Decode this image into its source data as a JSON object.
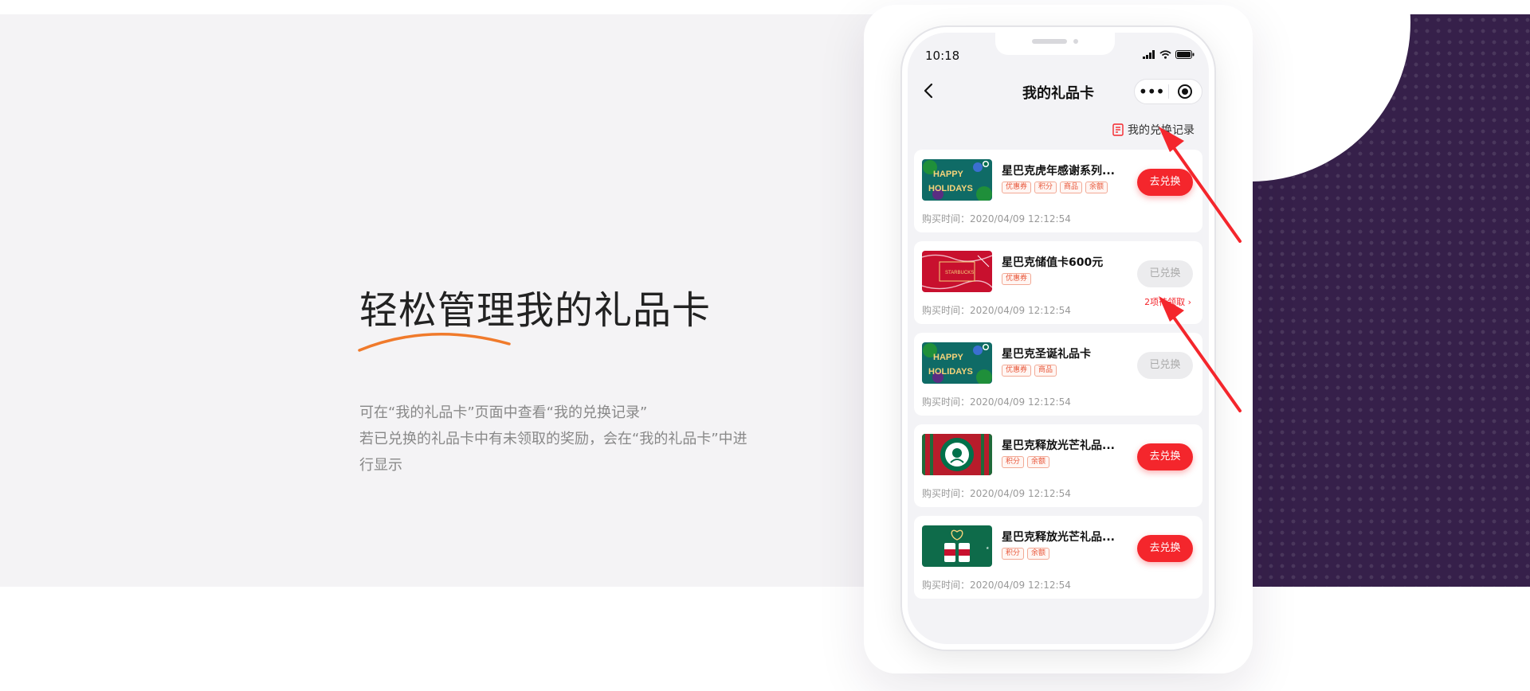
{
  "colors": {
    "accent": "#f4262c",
    "purple": "#36204a",
    "swoosh": "#f07a2b"
  },
  "feature": {
    "headline": "轻松管理我的礼品卡",
    "desc_line1": "可在“我的礼品卡”页面中查看“我的兑换记录”",
    "desc_line2": "若已兑换的礼品卡中有未领取的奖励，会在“我的礼品卡”中进行显示"
  },
  "phone": {
    "status_time": "10:18",
    "title": "我的礼品卡",
    "capsule_more": "•••",
    "records_link": "我的兑换记录",
    "cards": [
      {
        "name": "星巴克虎年感谢系列...",
        "tags": [
          "优惠券",
          "积分",
          "商品",
          "余额"
        ],
        "time": "购买时间：2020/04/09 12:12:54",
        "button": "去兑换",
        "thumb": "happy-holidays"
      },
      {
        "name": "星巴克储值卡600元",
        "tags": [
          "优惠券"
        ],
        "time": "购买时间：2020/04/09 12:12:54",
        "button": "已兑换",
        "pending": "2项待领取 ›",
        "thumb": "red-gift"
      },
      {
        "name": "星巴克圣诞礼品卡",
        "tags": [
          "优惠券",
          "商品"
        ],
        "time": "购买时间：2020/04/09 12:12:54",
        "button": "已兑换",
        "thumb": "happy-holidays"
      },
      {
        "name": "星巴克释放光芒礼品...",
        "tags": [
          "积分",
          "余额"
        ],
        "time": "购买时间：2020/04/09 12:12:54",
        "button": "去兑换",
        "thumb": "siren-logo"
      },
      {
        "name": "星巴克释放光芒礼品...",
        "tags": [
          "积分",
          "余额"
        ],
        "time": "购买时间：2020/04/09 12:12:54",
        "button": "去兑换",
        "thumb": "green-cups"
      }
    ]
  }
}
